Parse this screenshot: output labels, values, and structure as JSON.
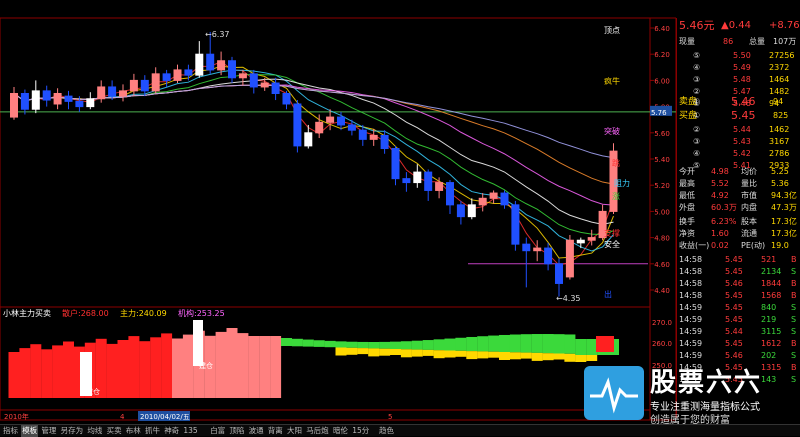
{
  "header": {
    "price_right": "6.40"
  },
  "main_chart": {
    "y_ticks": [
      "6.40",
      "6.20",
      "6.00",
      "5.80",
      "5.60",
      "5.40",
      "5.20",
      "5.00",
      "4.80",
      "4.60",
      "4.40"
    ],
    "annotations": {
      "high_price": "6.37",
      "low_price": "4.35",
      "top": "顶点",
      "catch_bull": "疯牛",
      "breakout": "突破",
      "resistance": "阻力",
      "jump": "跳",
      "support": "支撑",
      "safe": "安全",
      "exit": "出",
      "up": "涨"
    },
    "price_line_label": "5.76",
    "candles": [
      {
        "o": 5.72,
        "c": 5.9,
        "h": 5.95,
        "l": 5.7
      },
      {
        "o": 5.9,
        "c": 5.78,
        "h": 5.93,
        "l": 5.74
      },
      {
        "o": 5.78,
        "c": 5.92,
        "h": 6.0,
        "l": 5.75
      },
      {
        "o": 5.92,
        "c": 5.85,
        "h": 5.96,
        "l": 5.8
      },
      {
        "o": 5.82,
        "c": 5.9,
        "h": 5.94,
        "l": 5.78
      },
      {
        "o": 5.88,
        "c": 5.84,
        "h": 5.92,
        "l": 5.78
      },
      {
        "o": 5.84,
        "c": 5.8,
        "h": 5.88,
        "l": 5.76
      },
      {
        "o": 5.8,
        "c": 5.86,
        "h": 5.91,
        "l": 5.78
      },
      {
        "o": 5.86,
        "c": 5.95,
        "h": 6.0,
        "l": 5.83
      },
      {
        "o": 5.95,
        "c": 5.88,
        "h": 6.0,
        "l": 5.85
      },
      {
        "o": 5.88,
        "c": 5.92,
        "h": 5.97,
        "l": 5.84
      },
      {
        "o": 5.92,
        "c": 6.0,
        "h": 6.05,
        "l": 5.88
      },
      {
        "o": 6.0,
        "c": 5.92,
        "h": 6.04,
        "l": 5.88
      },
      {
        "o": 5.92,
        "c": 6.05,
        "h": 6.1,
        "l": 5.9
      },
      {
        "o": 6.05,
        "c": 6.0,
        "h": 6.08,
        "l": 5.95
      },
      {
        "o": 6.0,
        "c": 6.08,
        "h": 6.12,
        "l": 5.98
      },
      {
        "o": 6.08,
        "c": 6.04,
        "h": 6.12,
        "l": 6.0
      },
      {
        "o": 6.04,
        "c": 6.2,
        "h": 6.3,
        "l": 6.02
      },
      {
        "o": 6.2,
        "c": 6.08,
        "h": 6.37,
        "l": 6.05
      },
      {
        "o": 6.08,
        "c": 6.15,
        "h": 6.22,
        "l": 6.04
      },
      {
        "o": 6.15,
        "c": 6.02,
        "h": 6.18,
        "l": 5.98
      },
      {
        "o": 6.02,
        "c": 6.05,
        "h": 6.08,
        "l": 5.96
      },
      {
        "o": 6.05,
        "c": 5.95,
        "h": 6.08,
        "l": 5.9
      },
      {
        "o": 5.95,
        "c": 5.98,
        "h": 6.02,
        "l": 5.92
      },
      {
        "o": 5.98,
        "c": 5.9,
        "h": 6.02,
        "l": 5.85
      },
      {
        "o": 5.9,
        "c": 5.82,
        "h": 5.92,
        "l": 5.78
      },
      {
        "o": 5.82,
        "c": 5.5,
        "h": 5.85,
        "l": 5.45
      },
      {
        "o": 5.5,
        "c": 5.6,
        "h": 5.66,
        "l": 5.48
      },
      {
        "o": 5.6,
        "c": 5.68,
        "h": 5.74,
        "l": 5.56
      },
      {
        "o": 5.68,
        "c": 5.72,
        "h": 5.78,
        "l": 5.62
      },
      {
        "o": 5.72,
        "c": 5.66,
        "h": 5.76,
        "l": 5.62
      },
      {
        "o": 5.66,
        "c": 5.62,
        "h": 5.7,
        "l": 5.58
      },
      {
        "o": 5.62,
        "c": 5.55,
        "h": 5.66,
        "l": 5.5
      },
      {
        "o": 5.55,
        "c": 5.58,
        "h": 5.63,
        "l": 5.5
      },
      {
        "o": 5.58,
        "c": 5.48,
        "h": 5.62,
        "l": 5.44
      },
      {
        "o": 5.48,
        "c": 5.25,
        "h": 5.5,
        "l": 5.2
      },
      {
        "o": 5.25,
        "c": 5.22,
        "h": 5.3,
        "l": 5.15
      },
      {
        "o": 5.22,
        "c": 5.3,
        "h": 5.36,
        "l": 5.18
      },
      {
        "o": 5.3,
        "c": 5.16,
        "h": 5.32,
        "l": 5.08
      },
      {
        "o": 5.16,
        "c": 5.22,
        "h": 5.26,
        "l": 5.1
      },
      {
        "o": 5.22,
        "c": 5.05,
        "h": 5.24,
        "l": 4.98
      },
      {
        "o": 5.05,
        "c": 4.96,
        "h": 5.08,
        "l": 4.9
      },
      {
        "o": 4.96,
        "c": 5.05,
        "h": 5.1,
        "l": 4.94
      },
      {
        "o": 5.05,
        "c": 5.1,
        "h": 5.14,
        "l": 5.0
      },
      {
        "o": 5.1,
        "c": 5.14,
        "h": 5.16,
        "l": 5.06
      },
      {
        "o": 5.14,
        "c": 5.05,
        "h": 5.16,
        "l": 5.02
      },
      {
        "o": 5.05,
        "c": 4.75,
        "h": 5.08,
        "l": 4.7
      },
      {
        "o": 4.75,
        "c": 4.7,
        "h": 4.8,
        "l": 4.42
      },
      {
        "o": 4.7,
        "c": 4.72,
        "h": 4.78,
        "l": 4.62
      },
      {
        "o": 4.72,
        "c": 4.6,
        "h": 4.76,
        "l": 4.55
      },
      {
        "o": 4.6,
        "c": 4.45,
        "h": 4.64,
        "l": 4.35
      },
      {
        "o": 4.5,
        "c": 4.78,
        "h": 4.82,
        "l": 4.48
      },
      {
        "o": 4.76,
        "c": 4.78,
        "h": 4.8,
        "l": 4.72
      },
      {
        "o": 4.78,
        "c": 4.8,
        "h": 4.86,
        "l": 4.74
      },
      {
        "o": 4.8,
        "c": 5.0,
        "h": 5.05,
        "l": 4.78
      },
      {
        "o": 5.0,
        "c": 5.46,
        "h": 5.52,
        "l": 4.98
      }
    ]
  },
  "sub_chart": {
    "title": "小林主力买卖",
    "items": [
      {
        "label": "散户:",
        "value": "268.00"
      },
      {
        "label": "主力:",
        "value": "240.09"
      },
      {
        "label": "机构:",
        "value": "253.25"
      }
    ],
    "y_ticks": [
      "270.0",
      "260.0",
      "250.0"
    ],
    "marks": [
      "建仓",
      "建仓"
    ]
  },
  "time_axis": {
    "labels": [
      "2010年",
      "4",
      "2010/04/02/五",
      "5"
    ]
  },
  "quote": {
    "price": "5.46",
    "price_unit": "元",
    "change": "▲0.44",
    "change_pct": "+8.76",
    "volume_label": "现量",
    "volume": "86",
    "amount_label": "总量",
    "amount": "107万",
    "sells": [
      {
        "n": "⑤",
        "p": "5.50",
        "v": "27256"
      },
      {
        "n": "④",
        "p": "5.49",
        "v": "2372"
      },
      {
        "n": "③",
        "p": "5.48",
        "v": "1464"
      },
      {
        "n": "②",
        "p": "5.47",
        "v": "1482"
      },
      {
        "n": "①",
        "p": "5.46",
        "v": "94"
      }
    ],
    "sell_label": "卖盘",
    "buy_label": "买盘",
    "buys": [
      {
        "n": "①",
        "p": "5.45",
        "v": "825"
      },
      {
        "n": "②",
        "p": "5.44",
        "v": "1462"
      },
      {
        "n": "③",
        "p": "5.43",
        "v": "3167"
      },
      {
        "n": "④",
        "p": "5.42",
        "v": "2786"
      },
      {
        "n": "⑤",
        "p": "5.41",
        "v": "2933"
      }
    ],
    "stats": [
      [
        "今开",
        "4.98",
        "均价",
        "5.25"
      ],
      [
        "最高",
        "5.52",
        "量比",
        "5.36"
      ],
      [
        "最低",
        "4.92",
        "市值",
        "94.3亿"
      ],
      [
        "外盘",
        "60.3万",
        "内盘",
        "47.3万"
      ],
      [
        "换手",
        "6.23%",
        "股本",
        "17.3亿"
      ],
      [
        "净资",
        "1.60",
        "流通",
        "17.3亿"
      ],
      [
        "收益(一)",
        "0.02",
        "PE(动)",
        "19.0"
      ]
    ],
    "ticks": [
      {
        "t": "14:58",
        "p": "5.45",
        "v": "521",
        "f": "B"
      },
      {
        "t": "14:58",
        "p": "5.45",
        "v": "2134",
        "f": "S"
      },
      {
        "t": "14:58",
        "p": "5.46",
        "v": "1844",
        "f": "B"
      },
      {
        "t": "14:58",
        "p": "5.45",
        "v": "1568",
        "f": "B"
      },
      {
        "t": "14:59",
        "p": "5.45",
        "v": "840",
        "f": "S"
      },
      {
        "t": "14:59",
        "p": "5.45",
        "v": "219",
        "f": "S"
      },
      {
        "t": "14:59",
        "p": "5.44",
        "v": "3115",
        "f": "S"
      },
      {
        "t": "14:59",
        "p": "5.45",
        "v": "1612",
        "f": "B"
      },
      {
        "t": "14:59",
        "p": "5.46",
        "v": "202",
        "f": "S"
      },
      {
        "t": "14:59",
        "p": "5.45",
        "v": "1315",
        "f": "B"
      },
      {
        "t": "14:59",
        "p": "5.45",
        "v": "143",
        "f": "S"
      }
    ]
  },
  "bottom_tabs": [
    "指标",
    "模板",
    "管理",
    "另存为",
    "均线",
    "买卖",
    "布林",
    "抓牛",
    "神奇",
    "135",
    "白富",
    "顶陷",
    "波通",
    "背离",
    "大阳",
    "马后炮",
    "暗伦",
    "15分",
    "趋色"
  ],
  "logo": {
    "title": "股票六六",
    "subtitle1": "专业注重测海量指标公式",
    "subtitle2": "创造属于您的财富"
  }
}
